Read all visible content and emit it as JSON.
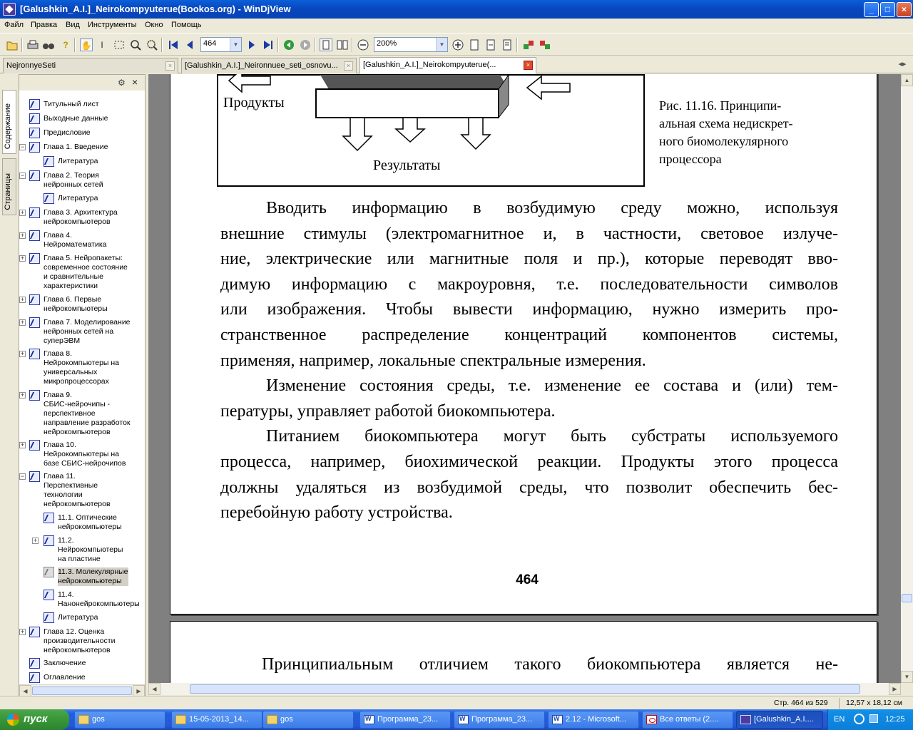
{
  "app": {
    "title": "[Galushkin_A.I.]_Neirokompyuterue(Bookos.org) - WinDjView",
    "window_buttons": {
      "minimize": "_",
      "maximize": "□",
      "close": "×"
    }
  },
  "menu": [
    "Файл",
    "Правка",
    "Вид",
    "Инструменты",
    "Окно",
    "Помощь"
  ],
  "toolbar": {
    "page_value": "464",
    "zoom_value": "200%",
    "icons": [
      "open-icon",
      "print-icon",
      "find-icon",
      "help-icon",
      "hand-icon",
      "select-text-icon",
      "select-rect-icon",
      "zoom-icon",
      "zoom-rect-icon",
      "first-page-icon",
      "prev-page-icon",
      "next-page-icon",
      "last-page-icon",
      "back-icon",
      "forward-icon",
      "single-page-icon",
      "two-page-icon",
      "zoom-out-icon",
      "zoom-in-icon",
      "fit-page-icon",
      "fit-width-icon",
      "rotate-left-icon",
      "rotate-right-icon"
    ]
  },
  "tabs": [
    {
      "label": "NejronnyeSeti",
      "active": false
    },
    {
      "label": "[Galushkin_A.I.]_Neironnuee_seti_osnovu...",
      "active": false
    },
    {
      "label": "[Galushkin_A.I.]_Neirokompyuterue(...",
      "active": true
    }
  ],
  "side_tabs": [
    "Содержание",
    "Страницы"
  ],
  "toc": [
    {
      "label": "Титульный лист",
      "indent": 0,
      "expand": "",
      "selected": false
    },
    {
      "label": "Выходные данные",
      "indent": 0,
      "expand": "",
      "selected": false
    },
    {
      "label": "Предисловие",
      "indent": 0,
      "expand": "",
      "selected": false
    },
    {
      "label": "Глава 1. Введение",
      "indent": 0,
      "expand": "−",
      "selected": false
    },
    {
      "label": "Литература",
      "indent": 1,
      "expand": "",
      "selected": false
    },
    {
      "label": "Глава 2. Теория\nнейронных сетей",
      "indent": 0,
      "expand": "−",
      "selected": false
    },
    {
      "label": "Литература",
      "indent": 1,
      "expand": "",
      "selected": false
    },
    {
      "label": "Глава 3. Архитектура\nнейрокомпьютеров",
      "indent": 0,
      "expand": "+",
      "selected": false
    },
    {
      "label": "Глава 4.\nНейроматематика",
      "indent": 0,
      "expand": "+",
      "selected": false
    },
    {
      "label": "Глава 5. Нейропакеты:\nсовременное состояние\nи сравнительные\nхарактеристики",
      "indent": 0,
      "expand": "+",
      "selected": false
    },
    {
      "label": "Глава 6. Первые\nнейрокомпьютеры",
      "indent": 0,
      "expand": "+",
      "selected": false
    },
    {
      "label": "Глава 7. Моделирование\nнейронных сетей на\nсуперЭВМ",
      "indent": 0,
      "expand": "+",
      "selected": false
    },
    {
      "label": "Глава 8.\nНейрокомпьютеры на\nуниверсальных\nмикропроцессорах",
      "indent": 0,
      "expand": "+",
      "selected": false
    },
    {
      "label": "Глава 9.\nСБИС-нейрочипы -\nперспективное\nнаправление разработок\nнейрокомпьютеров",
      "indent": 0,
      "expand": "+",
      "selected": false
    },
    {
      "label": "Глава 10.\nНейрокомпьютеры на\nбазе СБИС-нейрочипов",
      "indent": 0,
      "expand": "+",
      "selected": false
    },
    {
      "label": "Глава 11.\nПерспективные\nтехнологии\nнейрокомпьютеров",
      "indent": 0,
      "expand": "−",
      "selected": false
    },
    {
      "label": "11.1. Оптические\nнейрокомпьютеры",
      "indent": 1,
      "expand": "",
      "selected": false
    },
    {
      "label": "11.2.\nНейрокомпьютеры\nна пластине",
      "indent": 1,
      "expand": "+",
      "selected": false
    },
    {
      "label": "11.3. Молекулярные\nнейрокомпьютеры",
      "indent": 1,
      "expand": "",
      "selected": true
    },
    {
      "label": "11.4.\nНанонейрокомпьютеры",
      "indent": 1,
      "expand": "",
      "selected": false
    },
    {
      "label": "Литература",
      "indent": 1,
      "expand": "",
      "selected": false
    },
    {
      "label": "Глава 12. Оценка\nпроизводительности\nнейрокомпьютеров",
      "indent": 0,
      "expand": "+",
      "selected": false
    },
    {
      "label": "Заключение",
      "indent": 0,
      "expand": "",
      "selected": false
    },
    {
      "label": "Оглавление",
      "indent": 0,
      "expand": "",
      "selected": false
    }
  ],
  "page464": {
    "figure": {
      "products_label": "Продукты",
      "results_label": "Результаты",
      "caption": [
        "Рис. 11.16. Принципи-",
        "альная схема недискрет-",
        "ного биомолекулярного",
        "процессора"
      ]
    },
    "paragraphs": [
      {
        "lines": [
          "Вводить информацию в возбудимую среду можно, используя",
          "внешние стимулы (электромагнитное и, в частности, световое излуче-",
          "ние, электрические или магнитные поля и пр.), которые переводят вво-",
          "димую информацию с макроуровня, т.е. последовательности символов",
          "или изображения. Чтобы вывести информацию, нужно измерить про-",
          "странственное распределение концентраций компонентов системы,",
          "применяя, например, локальные спектральные измерения."
        ]
      },
      {
        "lines": [
          "Изменение состояния среды, т.е. изменение ее состава и (или) тем-",
          "пературы, управляет работой биокомпьютера."
        ]
      },
      {
        "lines": [
          "Питанием биокомпьютера могут быть субстраты используемого",
          "процесса, например, биохимической реакции. Продукты этого процесса",
          "должны удаляться из возбудимой среды, что позволит обеспечить бес-",
          "перебойную работу устройства."
        ]
      }
    ],
    "page_number": "464"
  },
  "page465": {
    "first_line": "Принципиальным отличием такого биокомпьютера является не-"
  },
  "status": {
    "page_info": "Стр. 464 из 529",
    "page_size": "12,57 x 18,12 см"
  },
  "taskbar": {
    "start": "пуск",
    "tasks": [
      {
        "label": "gos",
        "icon": "folder",
        "active": false
      },
      {
        "label": "15-05-2013_14...",
        "icon": "folder",
        "active": false
      },
      {
        "label": "gos",
        "icon": "folder",
        "active": false
      },
      {
        "label": "Программа_23...",
        "icon": "word",
        "active": false
      },
      {
        "label": "Программа_23...",
        "icon": "word",
        "active": false
      },
      {
        "label": "2.12 - Microsoft...",
        "icon": "word",
        "active": false
      },
      {
        "label": "Все ответы (2....",
        "icon": "pdf",
        "active": false
      },
      {
        "label": "[Galushkin_A.I....",
        "icon": "djv",
        "active": true
      }
    ],
    "lang": "EN",
    "clock": "12:25"
  },
  "colors": {
    "titlebar": "#0a5fd8",
    "taskbar": "#245edb",
    "start": "#3a9a3a",
    "selection": "#d4d0c8"
  }
}
